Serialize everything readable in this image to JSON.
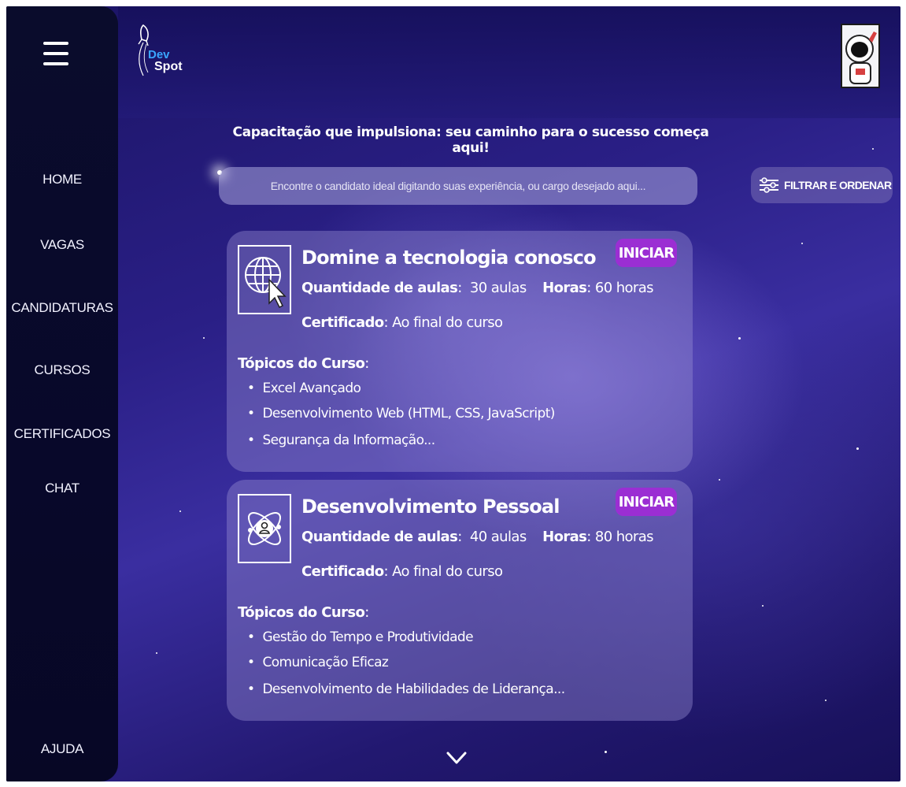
{
  "app": {
    "logo_line1": "Dev",
    "logo_line2": "Spot"
  },
  "sidebar": {
    "items": [
      {
        "label": "HOME"
      },
      {
        "label": "VAGAS"
      },
      {
        "label": "CANDIDATURAS"
      },
      {
        "label": "CURSOS"
      },
      {
        "label": "CERTIFICADOS"
      },
      {
        "label": "CHAT"
      }
    ],
    "help_label": "AJUDA"
  },
  "header": {
    "tagline": "Capacitação que impulsiona: seu caminho para o sucesso começa aqui!"
  },
  "search": {
    "placeholder": "Encontre o candidato ideal digitando suas experiência, ou cargo desejado aqui..."
  },
  "filter": {
    "label": "FILTRAR E ORDENAR"
  },
  "courses": [
    {
      "title": "Domine a tecnologia conosco",
      "lessons_label": "Quantidade de aulas",
      "lessons_value": "30 aulas",
      "hours_label": "Horas",
      "hours_value": "60 horas",
      "certificate_label": "Certificado",
      "certificate_value": "Ao final do curso",
      "start_label": "INICIAR",
      "topics_label": "Tópicos do Curso",
      "topics": [
        "Excel Avançado",
        "Desenvolvimento Web (HTML, CSS, JavaScript)",
        "Segurança da Informação..."
      ],
      "icon": "globe-cursor-icon"
    },
    {
      "title": "Desenvolvimento Pessoal",
      "lessons_label": "Quantidade de aulas",
      "lessons_value": "40 aulas",
      "hours_label": "Horas",
      "hours_value": "80 horas",
      "certificate_label": "Certificado",
      "certificate_value": "Ao final do curso",
      "start_label": "INICIAR",
      "topics_label": "Tópicos do Curso",
      "topics": [
        "Gestão do Tempo e Produtividade",
        "Comunicação Eficaz",
        "Desenvolvimento de Habilidades de Liderança..."
      ],
      "icon": "atom-person-icon"
    }
  ],
  "colors": {
    "accent": "#9b2ed3",
    "logo_dev": "#3aa6ff",
    "sidebar_bg": "#08082a"
  }
}
